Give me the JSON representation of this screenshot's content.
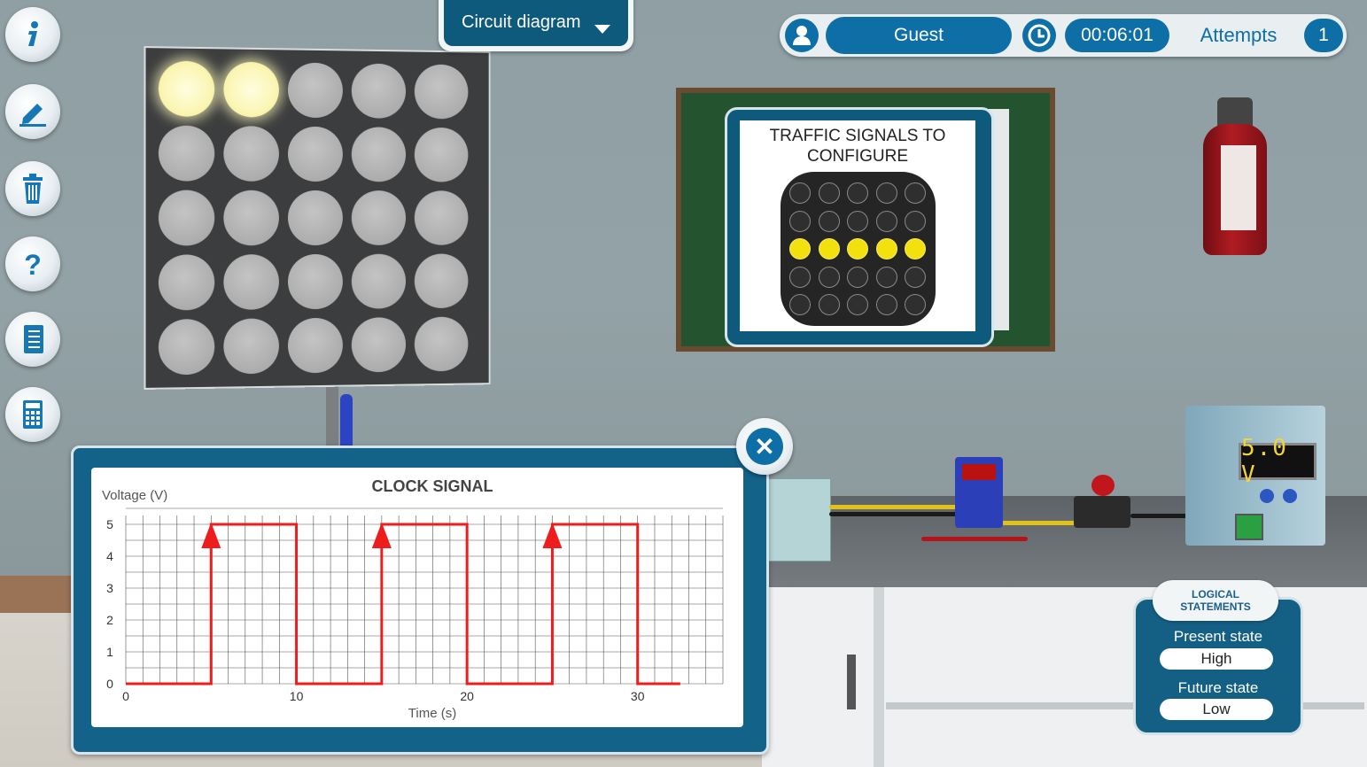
{
  "toolbar": {
    "items": [
      {
        "name": "info",
        "icon": "info-icon"
      },
      {
        "name": "edit",
        "icon": "pencil-icon"
      },
      {
        "name": "delete",
        "icon": "trash-icon"
      },
      {
        "name": "help",
        "icon": "question-icon"
      },
      {
        "name": "notes",
        "icon": "notebook-icon"
      },
      {
        "name": "calculator",
        "icon": "calculator-icon"
      }
    ]
  },
  "circuit_dropdown": {
    "label": "Circuit diagram"
  },
  "header": {
    "user": "Guest",
    "timer": "00:06:01",
    "attempts_label": "Attempts",
    "attempts_count": "1"
  },
  "led_matrix": {
    "rows": 5,
    "cols": 5,
    "lit": [
      [
        0,
        0
      ],
      [
        0,
        1
      ]
    ]
  },
  "signal_card": {
    "title_line1": "TRAFFIC SIGNALS TO",
    "title_line2": "CONFIGURE",
    "lit_row": 2
  },
  "power_supply": {
    "display": "5.0 V"
  },
  "logical_statements": {
    "title_line1": "LOGICAL",
    "title_line2": "STATEMENTS",
    "present_label": "Present state",
    "present_value": "High",
    "future_label": "Future state",
    "future_value": "Low"
  },
  "colors": {
    "accent_blue": "#0e6fa6",
    "signal_red": "#ee1c1c",
    "led_on": "#fbf6b4",
    "mini_led_on": "#f3e00f"
  },
  "chart_data": {
    "type": "line",
    "title": "CLOCK SIGNAL",
    "xlabel": "Time (s)",
    "ylabel": "Voltage (V)",
    "xlim": [
      0,
      35
    ],
    "ylim": [
      0,
      5
    ],
    "xticks": [
      0,
      10,
      20,
      30
    ],
    "yticks": [
      0,
      1,
      2,
      3,
      4,
      5
    ],
    "grid": true,
    "series": [
      {
        "x": [
          0,
          5,
          5,
          10,
          10,
          15,
          15,
          20,
          20,
          25,
          25,
          30,
          30,
          32.5
        ],
        "y": [
          0,
          0,
          5,
          5,
          0,
          0,
          5,
          5,
          0,
          0,
          5,
          5,
          0,
          0
        ],
        "rising_edge_arrows": [
          5,
          15,
          25
        ]
      }
    ]
  }
}
